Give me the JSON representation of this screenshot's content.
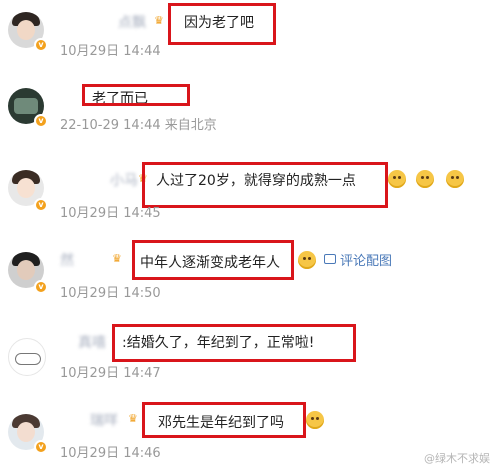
{
  "comments": [
    {
      "name": "点飘",
      "text": "因为老了吧",
      "date": "10月29日",
      "time": "14:44",
      "location": ""
    },
    {
      "name": "",
      "text": "老了而已",
      "date": "22-10-29",
      "time": "14:44",
      "location": "来自北京"
    },
    {
      "name": "小马",
      "text": "人过了20岁，就得穿的成熟一点",
      "date": "10月29日",
      "time": "14:45",
      "location": ""
    },
    {
      "name": "然",
      "text": "中年人逐渐变成老年人",
      "date": "10月29日",
      "time": "14:50",
      "location": "",
      "link": "评论配图"
    },
    {
      "name": "真嘻",
      "text": ":结婚久了，年纪到了，正常啦!",
      "date": "10月29日",
      "time": "14:47",
      "location": ""
    },
    {
      "name": "瑞咩",
      "text": "邓先生是年纪到了吗",
      "date": "10月29日",
      "time": "14:46",
      "location": ""
    }
  ],
  "watermark": "@绿木不求娱",
  "colors": {
    "highlight_box": "#d9151b",
    "meta_text": "#999999",
    "link": "#4a79b8"
  }
}
